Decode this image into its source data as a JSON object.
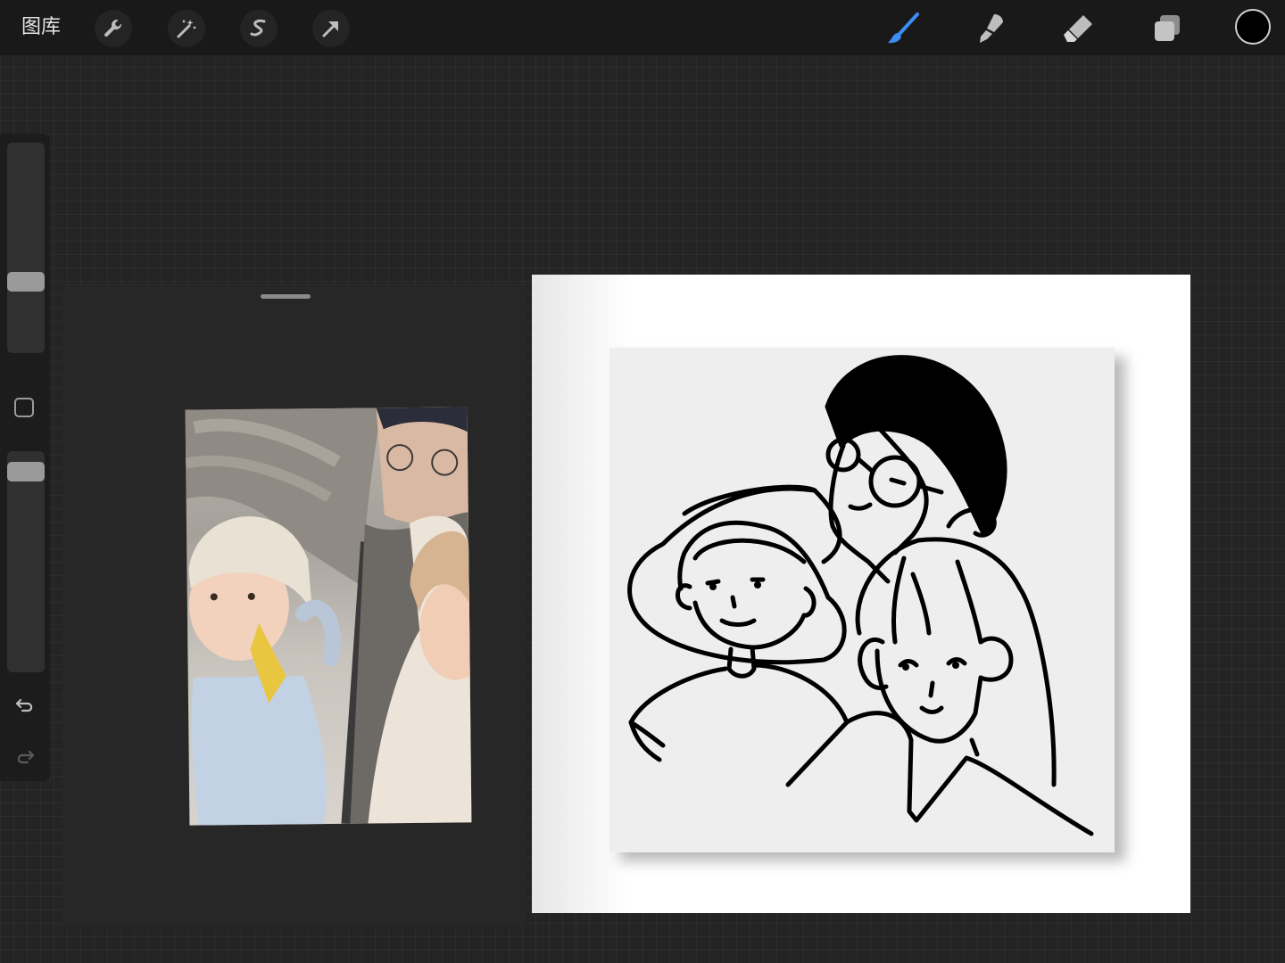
{
  "toolbar": {
    "gallery_label": "图库",
    "left_tools": [
      {
        "name": "actions",
        "icon": "wrench-icon"
      },
      {
        "name": "adjustments",
        "icon": "magic-wand-icon"
      },
      {
        "name": "selection",
        "icon": "selection-s-icon"
      },
      {
        "name": "transform",
        "icon": "arrow-cursor-icon"
      }
    ],
    "right_tools": [
      {
        "name": "brush",
        "icon": "brush-icon",
        "active": true,
        "accent": "#3a8ef6"
      },
      {
        "name": "smudge",
        "icon": "smudge-icon"
      },
      {
        "name": "eraser",
        "icon": "eraser-icon"
      },
      {
        "name": "layers",
        "icon": "layers-icon"
      }
    ],
    "current_color": "#000000"
  },
  "sidebar": {
    "brush_size_level": 0.33,
    "opacity_level": 0.92,
    "modify_icon": "square-icon",
    "undo_icon": "undo-icon",
    "redo_icon": "redo-icon"
  },
  "reference": {
    "handle_icon": "drag-handle-icon",
    "photo_subject": "family-selfie-photo"
  },
  "canvas": {
    "background": "#ffffff",
    "artboard": "#eeeeee",
    "line_color": "#000000"
  }
}
